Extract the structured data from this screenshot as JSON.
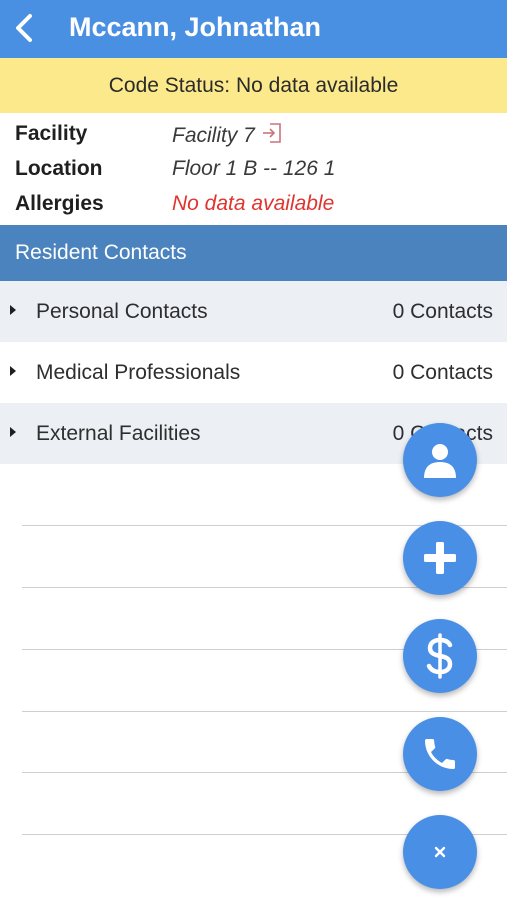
{
  "header": {
    "title": "Mccann, Johnathan",
    "back_icon": "chevron-left-icon"
  },
  "code_status": {
    "text": "Code Status: No data available",
    "background": "#fbe98b"
  },
  "details": [
    {
      "label": "Facility",
      "value": "Facility 7",
      "icon": "open-in-icon"
    },
    {
      "label": "Location",
      "value": "Floor 1 B -- 126 1"
    },
    {
      "label": "Allergies",
      "value": "No data available",
      "color": "#e0342f"
    }
  ],
  "contacts_section": {
    "title": "Resident Contacts",
    "items": [
      {
        "label": "Personal Contacts",
        "count": "0 Contacts"
      },
      {
        "label": "Medical Professionals",
        "count": "0 Contacts"
      },
      {
        "label": "External Facilities",
        "count": "0 Contacts"
      }
    ]
  },
  "fab_menu": [
    {
      "icon": "person-icon"
    },
    {
      "icon": "plus-icon"
    },
    {
      "icon": "dollar-icon"
    },
    {
      "icon": "phone-icon"
    },
    {
      "icon": "close-icon"
    }
  ],
  "colors": {
    "header": "#4a90e2",
    "section_header": "#4a83bd",
    "fab": "#4a8fe6",
    "alert_text": "#e0342f"
  }
}
